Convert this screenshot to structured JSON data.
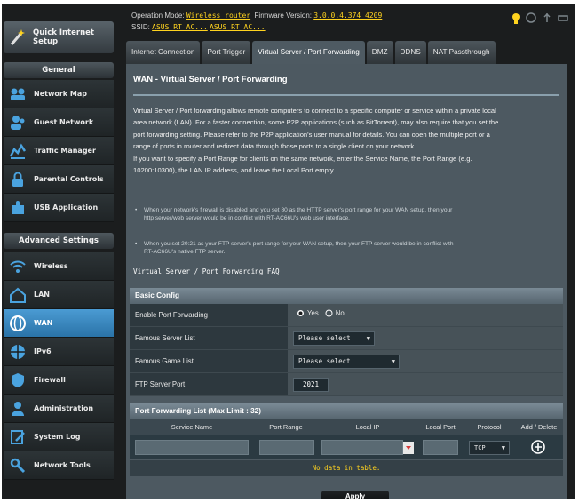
{
  "sidebar": {
    "quick_setup": "Quick Internet Setup",
    "general_heading": "General",
    "general_items": [
      "Network Map",
      "Guest Network",
      "Traffic Manager",
      "Parental Controls",
      "USB Application"
    ],
    "advanced_heading": "Advanced Settings",
    "advanced_items": [
      "Wireless",
      "LAN",
      "WAN",
      "IPv6",
      "Firewall",
      "Administration",
      "System Log",
      "Network Tools"
    ],
    "active_item": "WAN"
  },
  "topbar": {
    "op_mode_label": "Operation Mode:",
    "op_mode_value": "Wireless router",
    "firmware_label": "Firmware Version:",
    "firmware_value": "3.0.0.4.374_4209",
    "ssid_label": "SSID:",
    "ssid_1": "ASUS RT AC...",
    "ssid_2": "ASUS RT AC..."
  },
  "tabs": [
    "Internet Connection",
    "Port Trigger",
    "Virtual Server / Port Forwarding",
    "DMZ",
    "DDNS",
    "NAT Passthrough"
  ],
  "page": {
    "title": "WAN - Virtual Server / Port Forwarding",
    "description": [
      "Virtual Server / Port forwarding allows remote computers to connect to a specific computer or service within a private local",
      "area network (LAN). For a faster connection, some P2P applications (such as BitTorrent), may also require that you set the",
      "port forwarding setting. Please refer to the P2P application's user manual for details. You can open the multiple port or a",
      "range of ports in router and redirect data through those ports to a single client on your network.",
      "If you want to specify a Port Range for clients on the same network, enter the Service Name, the Port Range (e.g.",
      "10200:10300), the LAN IP address, and leave the Local Port empty."
    ],
    "note_1": [
      "When your network's firewall is disabled and you set 80 as the HTTP server's port range for your WAN setup, then your",
      "http server/web server would be in conflict with RT-AC66U's web user interface."
    ],
    "note_2": [
      "When you set 20:21 as your FTP server's port range for your WAN setup, then your FTP server would be in conflict with",
      "RT-AC66U's native FTP server."
    ],
    "faq_link": "Virtual Server / Port Forwarding FAQ"
  },
  "basic_config": {
    "heading": "Basic Config",
    "enable_label": "Enable Port Forwarding",
    "yes": "Yes",
    "no": "No",
    "enabled": "Yes",
    "famous_server_label": "Famous Server List",
    "famous_server_value": "Please select",
    "famous_game_label": "Famous Game List",
    "famous_game_value": "Please select",
    "ftp_port_label": "FTP Server Port",
    "ftp_port_value": "2021"
  },
  "pf_list": {
    "heading": "Port Forwarding List (Max Limit : 32)",
    "columns": [
      "Service Name",
      "Port Range",
      "Local IP",
      "Local Port",
      "Protocol",
      "Add / Delete"
    ],
    "protocol_value": "TCP",
    "no_data": "No data in table."
  },
  "apply_label": "Apply",
  "colors": {
    "accent": "#2a73a8",
    "link": "#ffd31f",
    "panel": "#4d5961"
  }
}
